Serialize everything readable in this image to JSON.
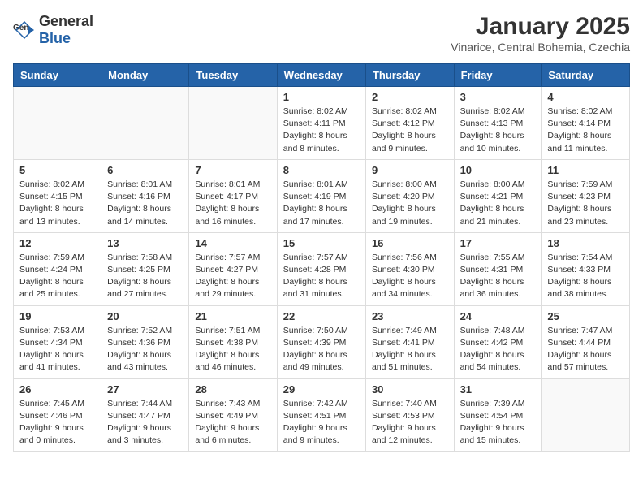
{
  "header": {
    "logo_general": "General",
    "logo_blue": "Blue",
    "month": "January 2025",
    "location": "Vinarice, Central Bohemia, Czechia"
  },
  "weekdays": [
    "Sunday",
    "Monday",
    "Tuesday",
    "Wednesday",
    "Thursday",
    "Friday",
    "Saturday"
  ],
  "weeks": [
    [
      {
        "day": "",
        "info": ""
      },
      {
        "day": "",
        "info": ""
      },
      {
        "day": "",
        "info": ""
      },
      {
        "day": "1",
        "info": "Sunrise: 8:02 AM\nSunset: 4:11 PM\nDaylight: 8 hours and 8 minutes."
      },
      {
        "day": "2",
        "info": "Sunrise: 8:02 AM\nSunset: 4:12 PM\nDaylight: 8 hours and 9 minutes."
      },
      {
        "day": "3",
        "info": "Sunrise: 8:02 AM\nSunset: 4:13 PM\nDaylight: 8 hours and 10 minutes."
      },
      {
        "day": "4",
        "info": "Sunrise: 8:02 AM\nSunset: 4:14 PM\nDaylight: 8 hours and 11 minutes."
      }
    ],
    [
      {
        "day": "5",
        "info": "Sunrise: 8:02 AM\nSunset: 4:15 PM\nDaylight: 8 hours and 13 minutes."
      },
      {
        "day": "6",
        "info": "Sunrise: 8:01 AM\nSunset: 4:16 PM\nDaylight: 8 hours and 14 minutes."
      },
      {
        "day": "7",
        "info": "Sunrise: 8:01 AM\nSunset: 4:17 PM\nDaylight: 8 hours and 16 minutes."
      },
      {
        "day": "8",
        "info": "Sunrise: 8:01 AM\nSunset: 4:19 PM\nDaylight: 8 hours and 17 minutes."
      },
      {
        "day": "9",
        "info": "Sunrise: 8:00 AM\nSunset: 4:20 PM\nDaylight: 8 hours and 19 minutes."
      },
      {
        "day": "10",
        "info": "Sunrise: 8:00 AM\nSunset: 4:21 PM\nDaylight: 8 hours and 21 minutes."
      },
      {
        "day": "11",
        "info": "Sunrise: 7:59 AM\nSunset: 4:23 PM\nDaylight: 8 hours and 23 minutes."
      }
    ],
    [
      {
        "day": "12",
        "info": "Sunrise: 7:59 AM\nSunset: 4:24 PM\nDaylight: 8 hours and 25 minutes."
      },
      {
        "day": "13",
        "info": "Sunrise: 7:58 AM\nSunset: 4:25 PM\nDaylight: 8 hours and 27 minutes."
      },
      {
        "day": "14",
        "info": "Sunrise: 7:57 AM\nSunset: 4:27 PM\nDaylight: 8 hours and 29 minutes."
      },
      {
        "day": "15",
        "info": "Sunrise: 7:57 AM\nSunset: 4:28 PM\nDaylight: 8 hours and 31 minutes."
      },
      {
        "day": "16",
        "info": "Sunrise: 7:56 AM\nSunset: 4:30 PM\nDaylight: 8 hours and 34 minutes."
      },
      {
        "day": "17",
        "info": "Sunrise: 7:55 AM\nSunset: 4:31 PM\nDaylight: 8 hours and 36 minutes."
      },
      {
        "day": "18",
        "info": "Sunrise: 7:54 AM\nSunset: 4:33 PM\nDaylight: 8 hours and 38 minutes."
      }
    ],
    [
      {
        "day": "19",
        "info": "Sunrise: 7:53 AM\nSunset: 4:34 PM\nDaylight: 8 hours and 41 minutes."
      },
      {
        "day": "20",
        "info": "Sunrise: 7:52 AM\nSunset: 4:36 PM\nDaylight: 8 hours and 43 minutes."
      },
      {
        "day": "21",
        "info": "Sunrise: 7:51 AM\nSunset: 4:38 PM\nDaylight: 8 hours and 46 minutes."
      },
      {
        "day": "22",
        "info": "Sunrise: 7:50 AM\nSunset: 4:39 PM\nDaylight: 8 hours and 49 minutes."
      },
      {
        "day": "23",
        "info": "Sunrise: 7:49 AM\nSunset: 4:41 PM\nDaylight: 8 hours and 51 minutes."
      },
      {
        "day": "24",
        "info": "Sunrise: 7:48 AM\nSunset: 4:42 PM\nDaylight: 8 hours and 54 minutes."
      },
      {
        "day": "25",
        "info": "Sunrise: 7:47 AM\nSunset: 4:44 PM\nDaylight: 8 hours and 57 minutes."
      }
    ],
    [
      {
        "day": "26",
        "info": "Sunrise: 7:45 AM\nSunset: 4:46 PM\nDaylight: 9 hours and 0 minutes."
      },
      {
        "day": "27",
        "info": "Sunrise: 7:44 AM\nSunset: 4:47 PM\nDaylight: 9 hours and 3 minutes."
      },
      {
        "day": "28",
        "info": "Sunrise: 7:43 AM\nSunset: 4:49 PM\nDaylight: 9 hours and 6 minutes."
      },
      {
        "day": "29",
        "info": "Sunrise: 7:42 AM\nSunset: 4:51 PM\nDaylight: 9 hours and 9 minutes."
      },
      {
        "day": "30",
        "info": "Sunrise: 7:40 AM\nSunset: 4:53 PM\nDaylight: 9 hours and 12 minutes."
      },
      {
        "day": "31",
        "info": "Sunrise: 7:39 AM\nSunset: 4:54 PM\nDaylight: 9 hours and 15 minutes."
      },
      {
        "day": "",
        "info": ""
      }
    ]
  ]
}
